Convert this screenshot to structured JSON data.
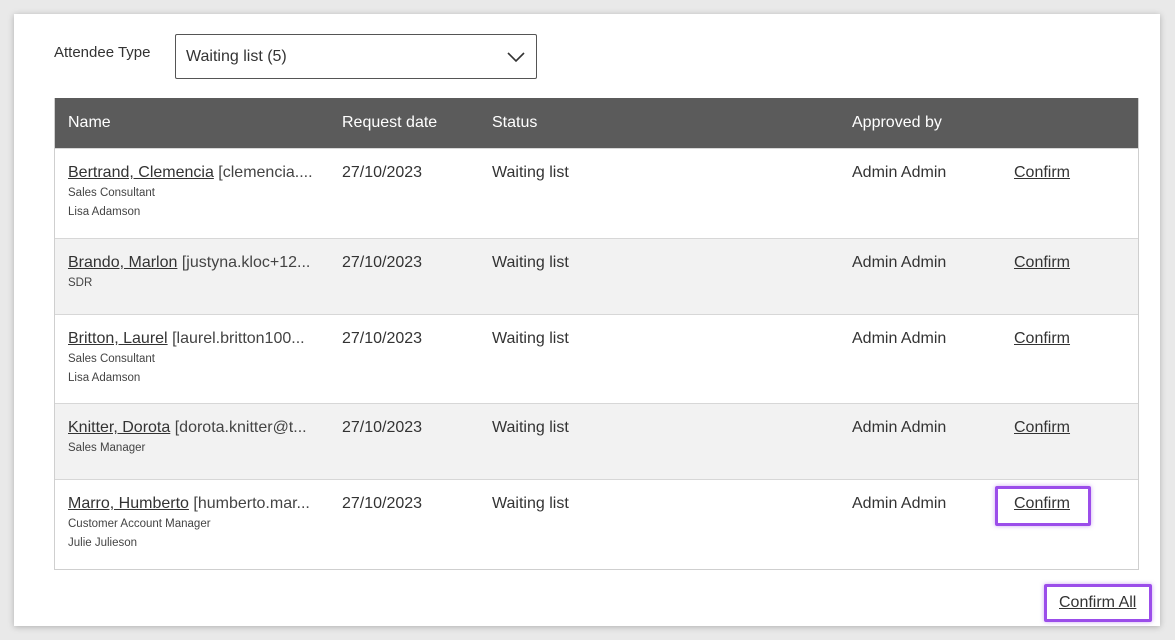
{
  "filter": {
    "label": "Attendee Type",
    "selected": "Waiting list (5)"
  },
  "table": {
    "headers": {
      "name": "Name",
      "request_date": "Request date",
      "status": "Status",
      "approved_by": "Approved by"
    },
    "rows": [
      {
        "name": "Bertrand, Clemencia",
        "email": "[clemencia....",
        "role": "Sales Consultant",
        "manager": "Lisa Adamson",
        "request_date": "27/10/2023",
        "status": "Waiting list",
        "approved_by": "Admin Admin",
        "action": "Confirm"
      },
      {
        "name": "Brando, Marlon",
        "email": "[justyna.kloc+12...",
        "role": "SDR",
        "manager": "",
        "request_date": "27/10/2023",
        "status": "Waiting list",
        "approved_by": "Admin Admin",
        "action": "Confirm"
      },
      {
        "name": "Britton, Laurel",
        "email": "[laurel.britton100...",
        "role": "Sales Consultant",
        "manager": "Lisa Adamson",
        "request_date": "27/10/2023",
        "status": "Waiting list",
        "approved_by": "Admin Admin",
        "action": "Confirm"
      },
      {
        "name": "Knitter, Dorota",
        "email": "[dorota.knitter@t...",
        "role": "Sales Manager",
        "manager": "",
        "request_date": "27/10/2023",
        "status": "Waiting list",
        "approved_by": "Admin Admin",
        "action": "Confirm"
      },
      {
        "name": "Marro, Humberto",
        "email": "[humberto.mar...",
        "role": "Customer Account Manager",
        "manager": "Julie Julieson",
        "request_date": "27/10/2023",
        "status": "Waiting list",
        "approved_by": "Admin Admin",
        "action": "Confirm"
      }
    ]
  },
  "footer": {
    "confirm_all": "Confirm All"
  },
  "colors": {
    "header_bg": "#5b5b5b",
    "highlight": "#9b4dea"
  }
}
